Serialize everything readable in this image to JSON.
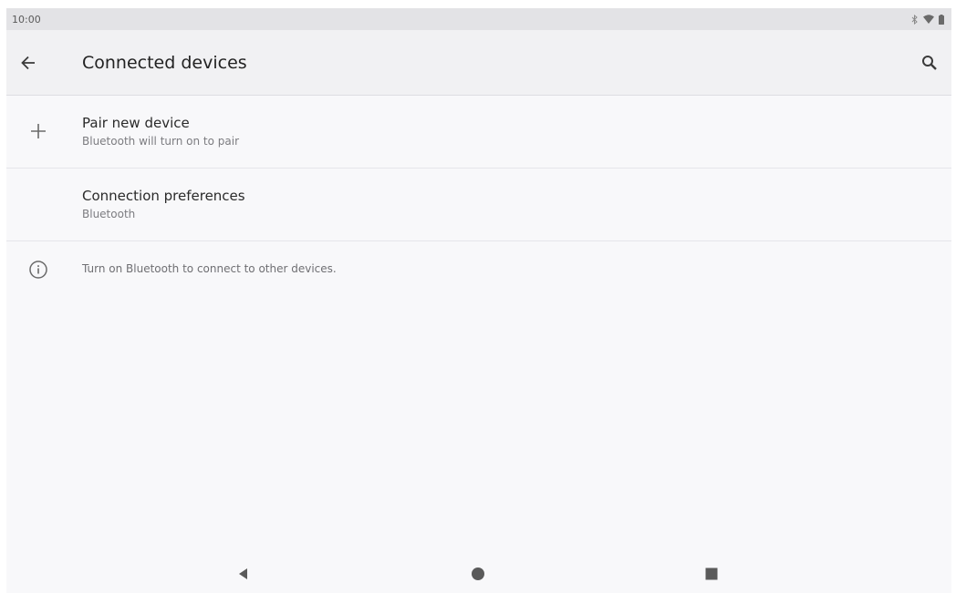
{
  "status_bar": {
    "time": "10:00",
    "icons": [
      "bluetooth-icon",
      "wifi-icon",
      "battery-icon"
    ]
  },
  "app_bar": {
    "title": "Connected devices",
    "back_icon": "arrow-left-icon",
    "search_icon": "search-icon"
  },
  "items": [
    {
      "icon": "plus-icon",
      "title": "Pair new device",
      "summary": "Bluetooth will turn on to pair"
    },
    {
      "icon": "",
      "title": "Connection preferences",
      "summary": "Bluetooth"
    }
  ],
  "info": {
    "icon": "info-icon",
    "text": "Turn on Bluetooth to connect to other devices."
  },
  "nav_bar": {
    "buttons": [
      "back-triangle-icon",
      "home-circle-icon",
      "recents-square-icon"
    ]
  },
  "colors": {
    "background": "#f8f8fa",
    "app_bar": "#f1f1f3",
    "status_bar": "#e3e3e6",
    "text_primary": "#222222",
    "text_secondary": "#7c7c80"
  }
}
